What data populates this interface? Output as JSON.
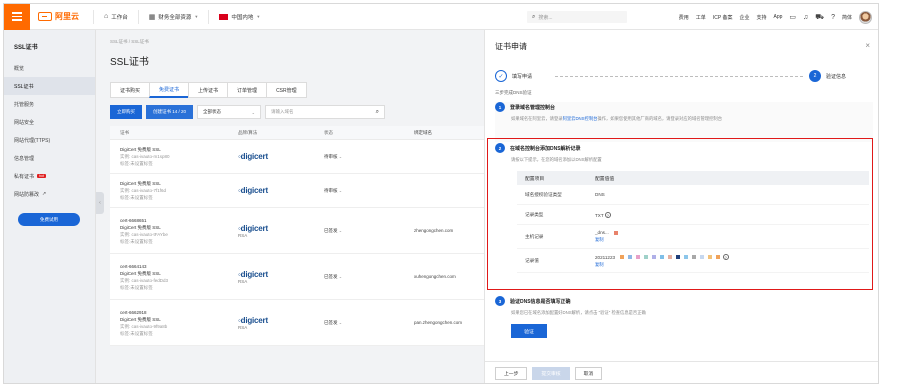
{
  "topbar": {
    "logo_text": "阿里云",
    "nav": [
      {
        "label": "工作台"
      },
      {
        "label": "财务全部资源"
      },
      {
        "label": "中国内地"
      }
    ],
    "search_placeholder": "搜索...",
    "right_items": [
      "费用",
      "工单",
      "ICP 备案",
      "企业",
      "支持",
      "App"
    ],
    "lang": "简体"
  },
  "sidebar": {
    "title": "SSL证书",
    "items": [
      {
        "label": "概览",
        "active": false
      },
      {
        "label": "SSL证书",
        "active": true
      },
      {
        "label": "托管服务",
        "active": false
      },
      {
        "label": "网站安全",
        "active": false
      },
      {
        "label": "网站代理(TTPS)",
        "active": false
      },
      {
        "label": "信息管理",
        "active": false
      },
      {
        "label": "私有证书",
        "active": false,
        "badge": "hot"
      },
      {
        "label": "网站防篡改",
        "active": false
      }
    ],
    "cta_label": "免费试用"
  },
  "main": {
    "breadcrumb": "SSL证书 / SSL证书",
    "title": "SSL证书",
    "tabs": [
      {
        "label": "证书购买",
        "active": false
      },
      {
        "label": "免费证书",
        "active": true
      },
      {
        "label": "上传证书",
        "active": false
      },
      {
        "label": "订单管理",
        "active": false
      },
      {
        "label": "CSR管理",
        "active": false
      }
    ],
    "buy_btn": "立即购买",
    "create_btn": "创建证书 14 / 20",
    "status_select": "全部状态",
    "search_placeholder": "请输入域名",
    "columns": [
      "证书",
      "品牌/算法",
      "状态",
      "绑定域名"
    ],
    "rows": [
      {
        "id": "",
        "name": "DigiCert 免费版 SSL",
        "detail1": "实例: cas-ivauto-m1sp80",
        "detail2": "标签:未设置标签",
        "brand": "digicert",
        "algo": "",
        "status": "待审核",
        "domain": ""
      },
      {
        "id": "",
        "name": "DigiCert 免费版 SSL",
        "detail1": "实例: cas-ivauto-7f1f6d",
        "detail2": "标签:未设置标签",
        "brand": "digicert",
        "algo": "",
        "status": "待审核",
        "domain": ""
      },
      {
        "id": "cert-6668651",
        "name": "DigiCert 免费版 SSL",
        "detail1": "实例: cas-ivauto-tFAYbe",
        "detail2": "标签:未设置标签",
        "brand": "digicert",
        "algo": "RSA",
        "status": "已签发",
        "domain": "zhengongchen.com"
      },
      {
        "id": "cert-6664143",
        "name": "DigiCert 免费版 SSL",
        "detail1": "实例: cas-ivauto-fedDd3",
        "detail2": "标签:未设置标签",
        "brand": "digicert",
        "algo": "RSA",
        "status": "已签发",
        "domain": "xuhengongchen.com"
      },
      {
        "id": "cert-6662918",
        "name": "DigiCert 免费版 SSL",
        "detail1": "实例: cas-ivauto-9f9a8b",
        "detail2": "标签:未设置标签",
        "brand": "digicert",
        "algo": "RSA",
        "status": "已签发",
        "domain": "pan.zhengongchen.com"
      }
    ]
  },
  "modal": {
    "title": "证书申请",
    "close": "×",
    "step1_label": "填写申请",
    "step2_label": "验证信息",
    "step2_num": "2",
    "subtitle": "三步完成DNS验证",
    "sec1": {
      "num": "1",
      "title": "登录域名管理控制台",
      "desc_pre": "如果域名在阿里云，请登录",
      "desc_link": "阿里云DNS控制台",
      "desc_post": "操作，如果您使用其他厂商的域名，请登录对应的域名管理控制台"
    },
    "sec2": {
      "num": "2",
      "title": "在域名控制台添加DNS解析记录",
      "desc": "请按以下提示，在您的域名添加以DNS解析配置",
      "head_k": "配置项目",
      "head_v": "配置值值",
      "rows": [
        {
          "k": "域名授权验证类型",
          "v": "DNS"
        },
        {
          "k": "记录类型",
          "v": "TXT"
        },
        {
          "k": "主机记录",
          "v": "_dns..."
        },
        {
          "k": "记录值",
          "v": "20211223"
        }
      ],
      "copy": "复制"
    },
    "sec3": {
      "num": "3",
      "title": "验证DNS信息是否填写正确",
      "desc": "如果您已在域名添加配置好DNS解析，请点击 \"验证\" 检查信息是否正确",
      "verify_btn": "验证"
    },
    "footer": {
      "prev": "上一步",
      "submit": "提交审核",
      "cancel": "取消"
    }
  }
}
